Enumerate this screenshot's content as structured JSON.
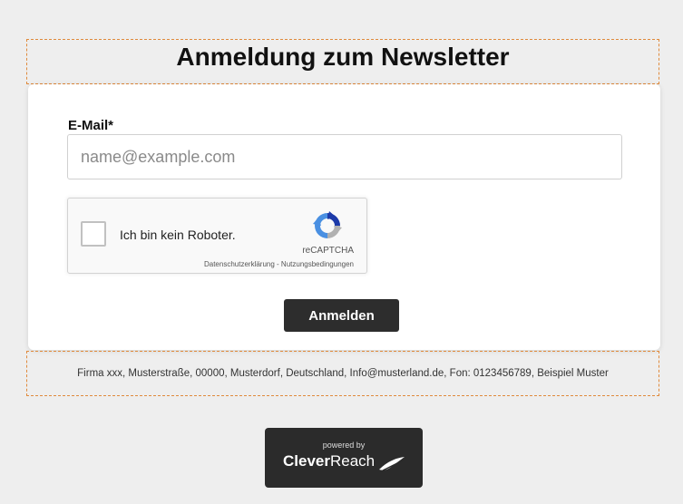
{
  "header": {
    "title": "Anmeldung zum Newsletter"
  },
  "form": {
    "email_label": "E-Mail*",
    "email_placeholder": "name@example.com",
    "email_value": "",
    "submit_label": "Anmelden"
  },
  "captcha": {
    "checkbox_label": "Ich bin kein Roboter.",
    "brand": "reCAPTCHA",
    "privacy_link": "Datenschutzerklärung",
    "separator": " - ",
    "terms_link": "Nutzungsbedingungen",
    "checked": false,
    "icon": "recaptcha-logo-icon"
  },
  "footer": {
    "imprint": "Firma xxx, Musterstraße, 00000, Musterdorf, Deutschland, Info@musterland.de, Fon: 0123456789, Beispiel Muster"
  },
  "badge": {
    "powered_by": "powered by",
    "brand_bold": "Clever",
    "brand_regular": "Reach",
    "icon": "cleverreach-swoosh-icon"
  },
  "colors": {
    "page_bg": "#eeeeee",
    "card_bg": "#ffffff",
    "button_bg": "#2d2d2d",
    "dashed_border": "#e08a3c",
    "recaptcha_blue": "#4a90e2",
    "recaptcha_dark_blue": "#1c3aa9",
    "recaptcha_grey": "#b1b1b1"
  }
}
